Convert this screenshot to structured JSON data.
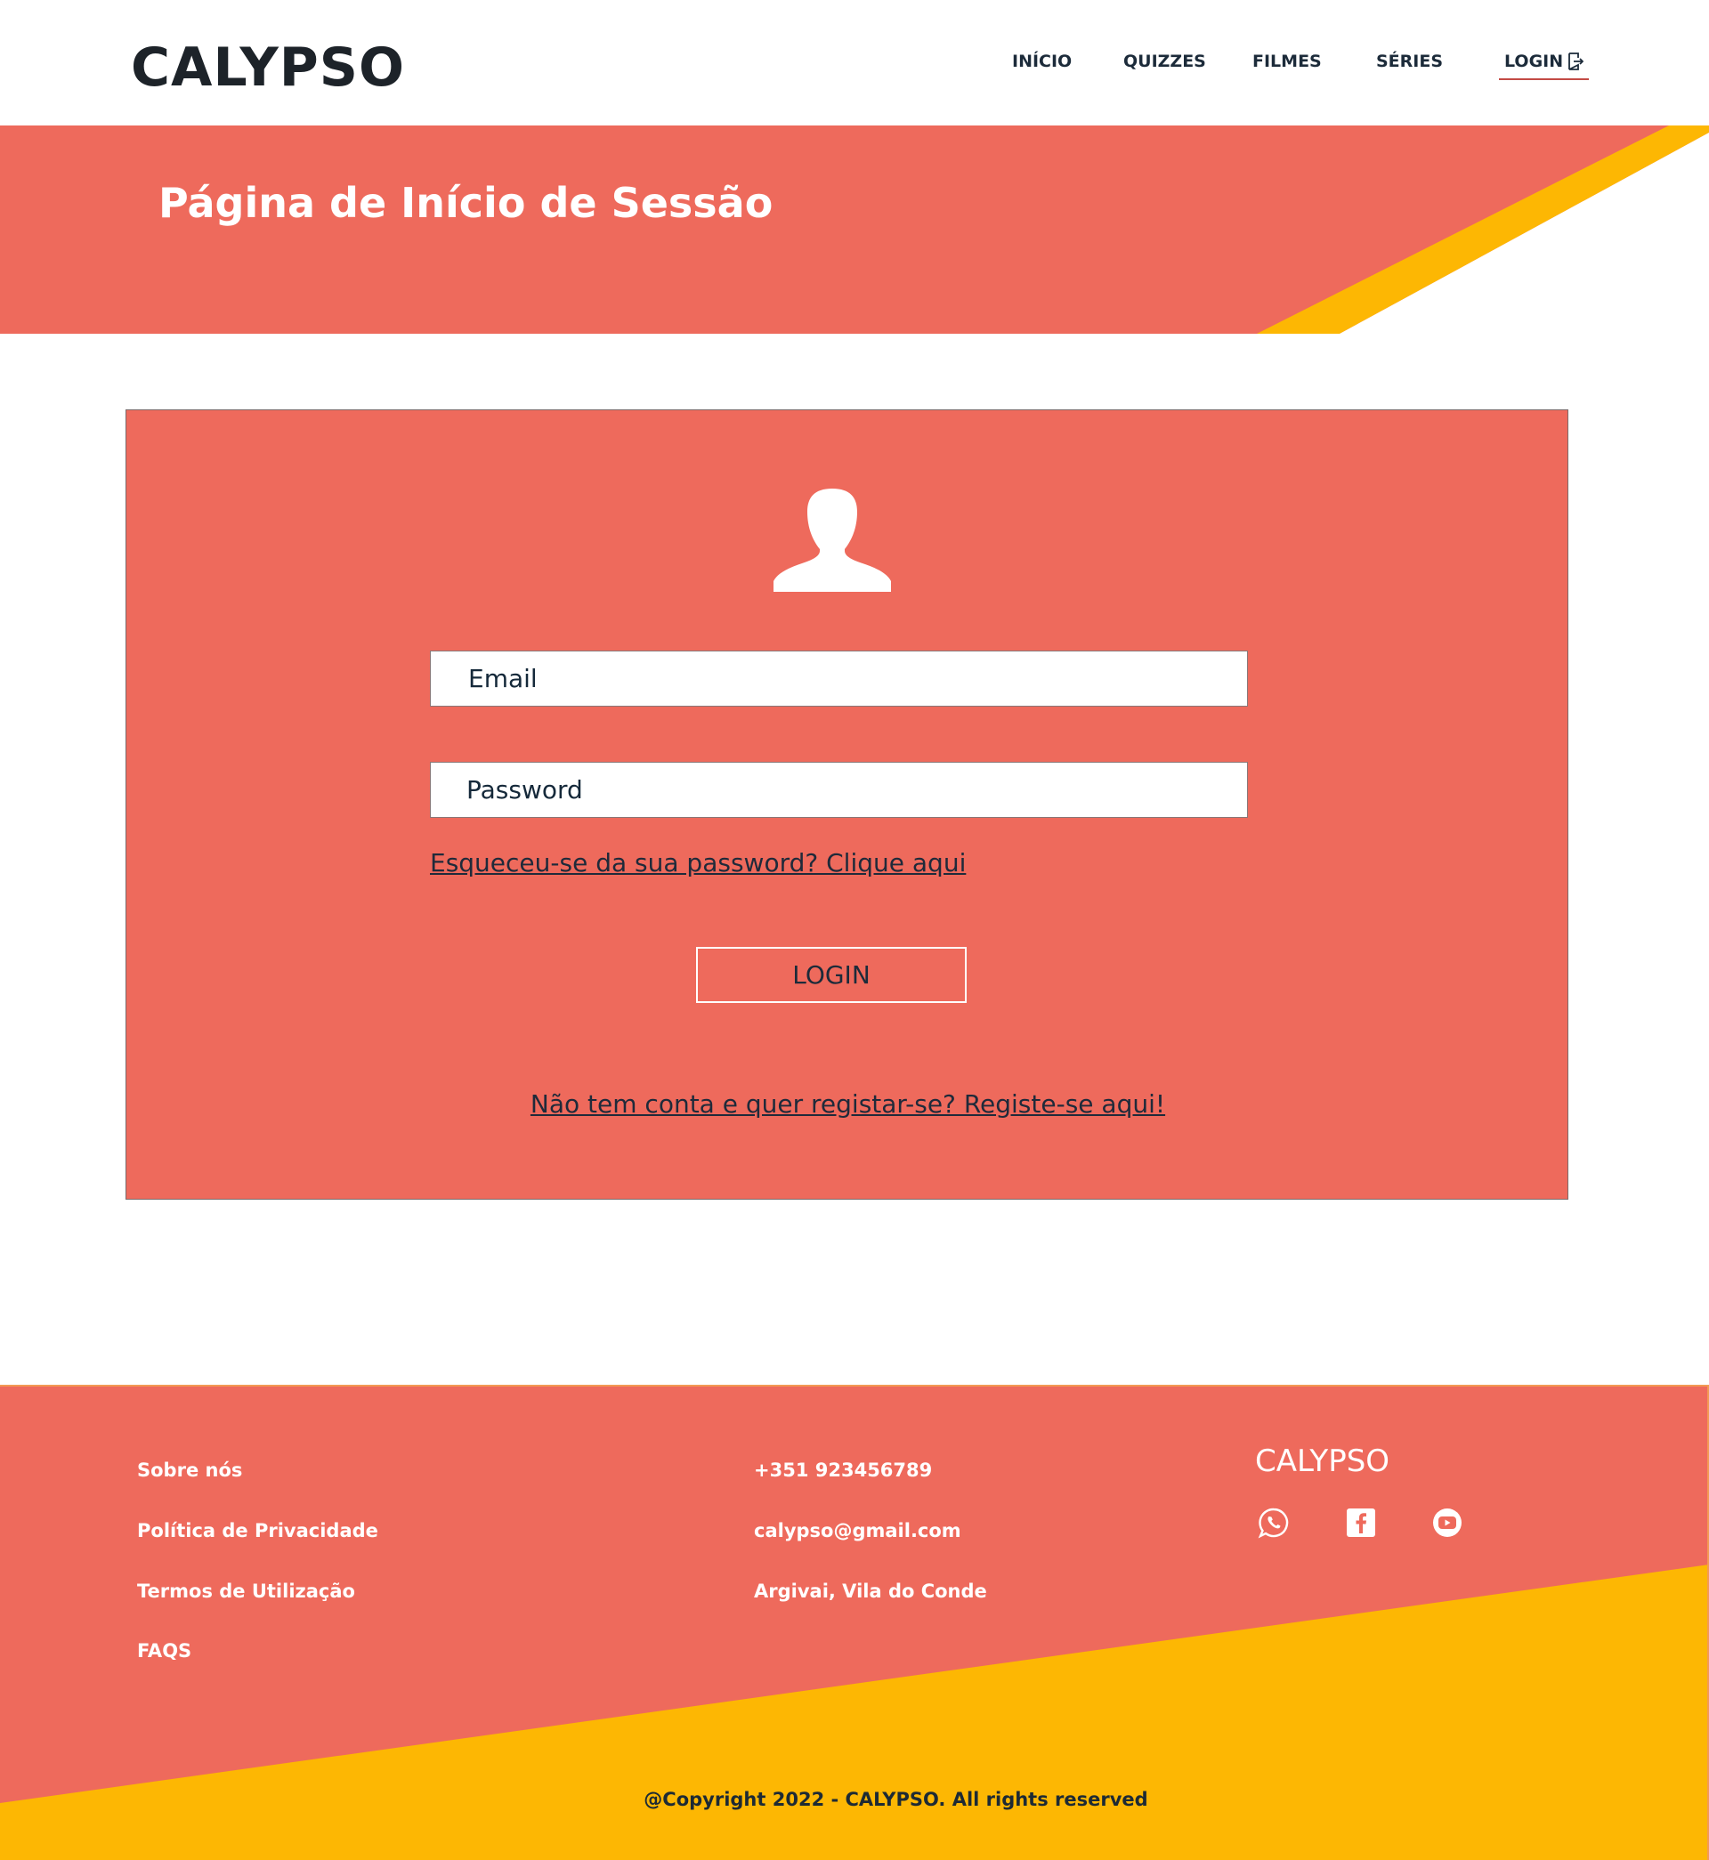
{
  "colors": {
    "coral": "#ee6a5c",
    "yellow": "#fdb703",
    "dark_text": "#1c2b3a",
    "white": "#ffffff"
  },
  "header": {
    "logo": "CALYPSO",
    "nav": {
      "inicio": "INÍCIO",
      "quizzes": "QUIZZES",
      "filmes": "FILMES",
      "series": "SÉRIES",
      "login": "LOGIN"
    }
  },
  "banner": {
    "title": "Página de Início de Sessão"
  },
  "login_form": {
    "user_icon": "user-icon",
    "email_placeholder": "Email",
    "password_placeholder": "Password",
    "forgot_password": "Esqueceu-se da sua password? Clique aqui",
    "login_button": "LOGIN",
    "register": "Não tem conta e quer registar-se? Registe-se aqui!"
  },
  "footer": {
    "links": {
      "about": "Sobre nós",
      "privacy": "Política de Privacidade",
      "terms": "Termos de Utilização",
      "faqs": "FAQS"
    },
    "contact": {
      "phone": "+351 923456789",
      "email": "calypso@gmail.com",
      "address": "Argivai, Vila do Conde"
    },
    "brand": "CALYPSO",
    "social_icons": [
      "whatsapp-icon",
      "facebook-icon",
      "youtube-icon"
    ],
    "copyright": "@Copyright 2022 - CALYPSO. All rights reserved"
  }
}
